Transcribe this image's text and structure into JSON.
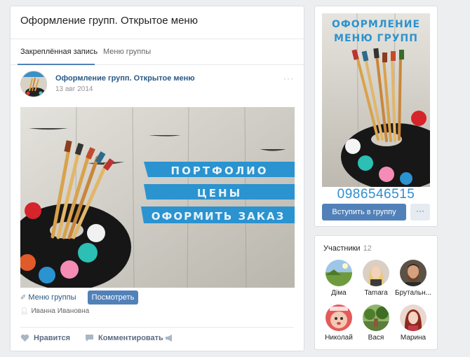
{
  "main": {
    "title": "Оформление групп. Открытое меню",
    "tabs": [
      {
        "label": "Закреплённая запись",
        "active": true
      },
      {
        "label": "Меню группы",
        "active": false
      }
    ]
  },
  "post": {
    "author": "Оформление групп. Открытое меню",
    "date": "13 авг 2014",
    "more": "···",
    "image_menu": [
      "ПОРТФОЛИО",
      "ЦЕНЫ",
      "ОФОРМИТЬ ЗАКАЗ"
    ],
    "link_label": "Меню группы",
    "view_button": "Посмотреть",
    "signer": "Иванна Ивановна",
    "like_label": "Нравится",
    "comment_label": "Комментировать"
  },
  "group": {
    "cover_title": [
      "ОФОРМЛЕНИЕ",
      "МЕНЮ ГРУПП"
    ],
    "phone": "0986546515",
    "join_button": "Вступить в группу",
    "more_button": "···"
  },
  "members": {
    "title": "Участники",
    "count": "12",
    "list": [
      {
        "name": "Діма",
        "avatar": "landscape"
      },
      {
        "name": "Tamara",
        "avatar": "woman-blonde"
      },
      {
        "name": "Брутальн...",
        "avatar": "man-beard"
      },
      {
        "name": "Николай",
        "avatar": "cartoon"
      },
      {
        "name": "Вася",
        "avatar": "park"
      },
      {
        "name": "Марина",
        "avatar": "woman-red"
      }
    ]
  },
  "colors": {
    "accent": "#5181b8",
    "link": "#2a5885",
    "background": "#edeef0",
    "banner": "#2a93d0",
    "phone": "#2f8ed0"
  }
}
